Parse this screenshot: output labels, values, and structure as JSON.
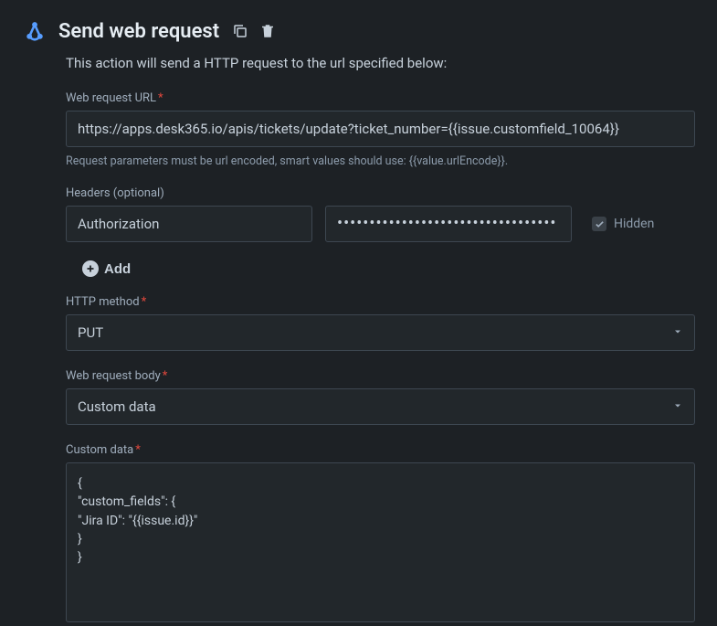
{
  "header": {
    "title": "Send web request"
  },
  "description": "This action will send a HTTP request to the url specified below:",
  "url": {
    "label": "Web request URL",
    "value": "https://apps.desk365.io/apis/tickets/update?ticket_number={{issue.customfield_10064}}",
    "helper": "Request parameters must be url encoded, smart values should use: {{value.urlEncode}}."
  },
  "headers": {
    "label": "Headers (optional)",
    "key_value": "Authorization",
    "value_masked": "••••••••••••••••••••••••••••••••••",
    "hidden_label": "Hidden",
    "add_label": "Add"
  },
  "method": {
    "label": "HTTP method",
    "value": "PUT"
  },
  "body": {
    "label": "Web request body",
    "value": "Custom data"
  },
  "custom_data": {
    "label": "Custom data",
    "value": "{\n\"custom_fields\": {\n\"Jira ID\": \"{{issue.id}}\"\n}\n}"
  }
}
